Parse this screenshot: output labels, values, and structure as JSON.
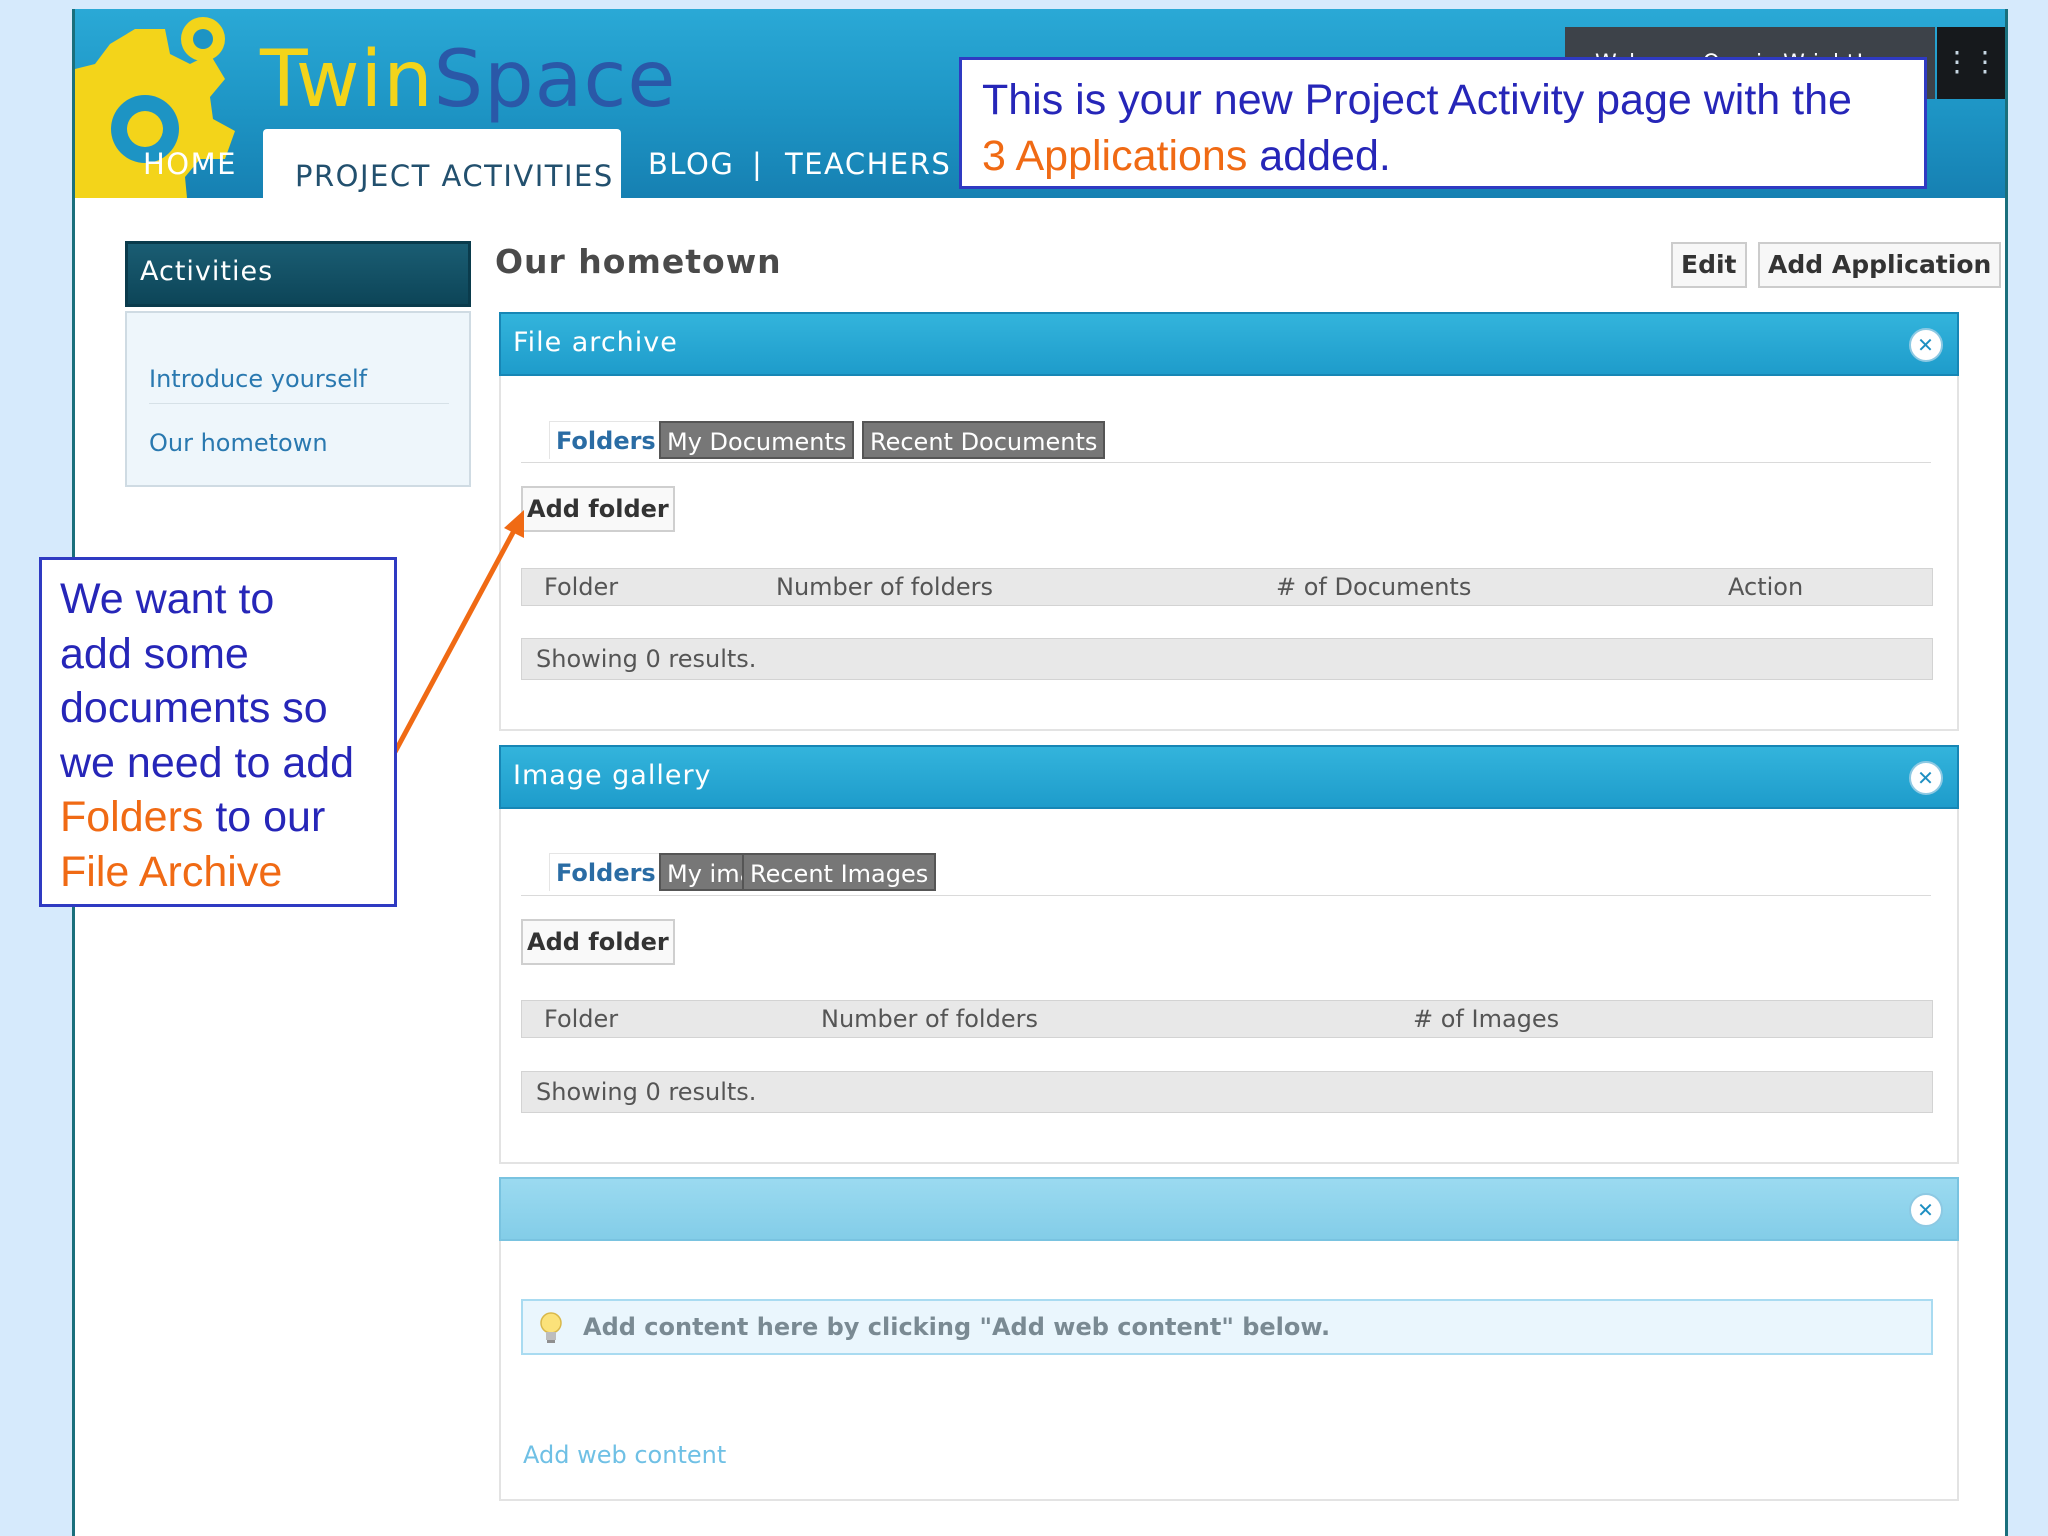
{
  "header": {
    "logo_twin": "Twin",
    "logo_space": "Space",
    "nav": {
      "home": "HOME",
      "activities": "PROJECT ACTIVITIES",
      "blog": "BLOG",
      "sep": "|",
      "teachers": "TEACHERS"
    },
    "welcome": "Welcome Orgain Wright!",
    "menu_icon": "chevron-menu-icon"
  },
  "sidebar": {
    "title": "Activities",
    "items": [
      {
        "label": "Introduce yourself"
      },
      {
        "label": "Our hometown"
      }
    ]
  },
  "main": {
    "title": "Our hometown",
    "edit_label": "Edit",
    "add_application_label": "Add Application"
  },
  "file_archive": {
    "title": "File archive",
    "tabs": [
      {
        "label": "Folders"
      },
      {
        "label": "My Documents"
      },
      {
        "label": "Recent Documents"
      }
    ],
    "add_folder_label": "Add folder",
    "columns": [
      "Folder",
      "Number of folders",
      "# of Documents",
      "Action"
    ],
    "results": "Showing 0 results."
  },
  "image_gallery": {
    "title": "Image gallery",
    "tabs": [
      {
        "label": "Folders"
      },
      {
        "label": "My images"
      },
      {
        "label": "Recent Images"
      }
    ],
    "add_folder_label": "Add folder",
    "columns": [
      "Folder",
      "Number of folders",
      "# of Images"
    ],
    "results": "Showing 0 results."
  },
  "web_content": {
    "title": "",
    "info": "Add content here by clicking \"Add web content\" below.",
    "add_link": "Add web content"
  },
  "callouts": {
    "top": {
      "line1": "This is your new Project Activity page with the",
      "highlight": "3 Applications",
      "rest": " added."
    },
    "left": {
      "l1": "We want to",
      "l2": "add some",
      "l3": "documents so",
      "l4": "we need to add",
      "l5_orange": "Folders",
      "l5_rest": " to our",
      "l6_orange": "File Archive"
    }
  },
  "colors": {
    "header_blue": "#1d94c4",
    "logo_yellow": "#f3d41a",
    "logo_blue": "#2a58a8",
    "callout_blue": "#2626b8",
    "callout_orange": "#f06a14",
    "sidebar_dark": "#0d4558"
  }
}
